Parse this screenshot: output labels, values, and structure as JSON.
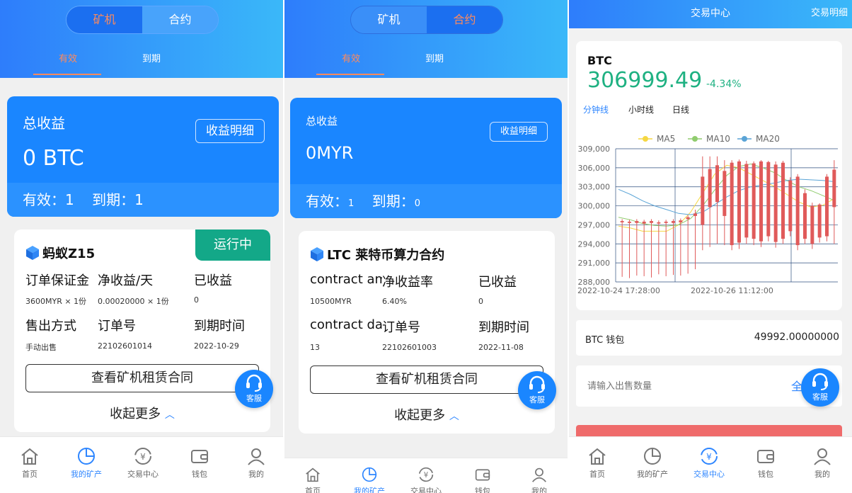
{
  "panel1": {
    "seg": [
      "矿机",
      "合约"
    ],
    "tabs": [
      "有效",
      "到期"
    ],
    "earn": {
      "title": "总收益",
      "btn": "收益明细",
      "value": "0 BTC",
      "active_label": "有效：",
      "active_val": "1",
      "expired_label": "到期：",
      "expired_val": "1"
    },
    "card": {
      "name": "蚂蚁Z15",
      "badge": "运行中",
      "h1": "订单保证金",
      "h2": "净收益/天",
      "h3": "已收益",
      "v1": "3600MYR × 1份",
      "v2": "0.00020000 × 1份",
      "v3": "0",
      "h4": "售出方式",
      "h5": "订单号",
      "h6": "到期时间",
      "v4": "手动出售",
      "v5": "22102601014",
      "v6": "2022-10-29",
      "contract": "查看矿机租赁合同",
      "more": "收起更多"
    }
  },
  "panel2": {
    "seg": [
      "矿机",
      "合约"
    ],
    "tabs": [
      "有效",
      "到期"
    ],
    "earn": {
      "title": "总收益",
      "btn": "收益明细",
      "value": "0MYR",
      "active_label": "有效：",
      "active_val": "1",
      "expired_label": "到期：",
      "expired_val": "0"
    },
    "card": {
      "name": "LTC 莱特币算力合约",
      "h1": "contract amo",
      "h2": "净收益率",
      "h3": "已收益",
      "v1": "10500MYR",
      "v2": "6.40%",
      "v3": "0",
      "h4": "contract day",
      "h5": "订单号",
      "h6": "到期时间",
      "v4": "13",
      "v5": "22102601003",
      "v6": "2022-11-08",
      "contract": "查看矿机租赁合同",
      "more": "收起更多"
    }
  },
  "kefu": "客服",
  "nav": [
    "首页",
    "我的矿产",
    "交易中心",
    "钱包",
    "我的"
  ],
  "panel3": {
    "title": "交易中心",
    "right": "交易明细",
    "symbol": "BTC",
    "price": "306999.49",
    "change": "-4.34%",
    "timeframes": [
      "分钟线",
      "小时线",
      "日线"
    ],
    "legend": [
      "MA5",
      "MA10",
      "MA20"
    ],
    "wallet_label": "BTC 钱包",
    "wallet_value": "49992.00000000",
    "sell_placeholder": "请输入出售数量",
    "sell_all": "全"
  },
  "chart_data": {
    "type": "candlestick",
    "yticks": [
      "309,000",
      "306,000",
      "303,000",
      "300,000",
      "297,000",
      "294,000",
      "291,000",
      "288,000"
    ],
    "xticks": [
      "2022-10-24 17:28:00",
      "2022-10-26 11:12:00"
    ],
    "ylim": [
      288000,
      309000
    ],
    "series": [
      {
        "name": "MA5"
      },
      {
        "name": "MA10"
      },
      {
        "name": "MA20"
      }
    ],
    "colors": {
      "MA5": "#f5d742",
      "MA10": "#90cc6e",
      "MA20": "#5aa4d6",
      "candle": "#e05a5a"
    }
  }
}
